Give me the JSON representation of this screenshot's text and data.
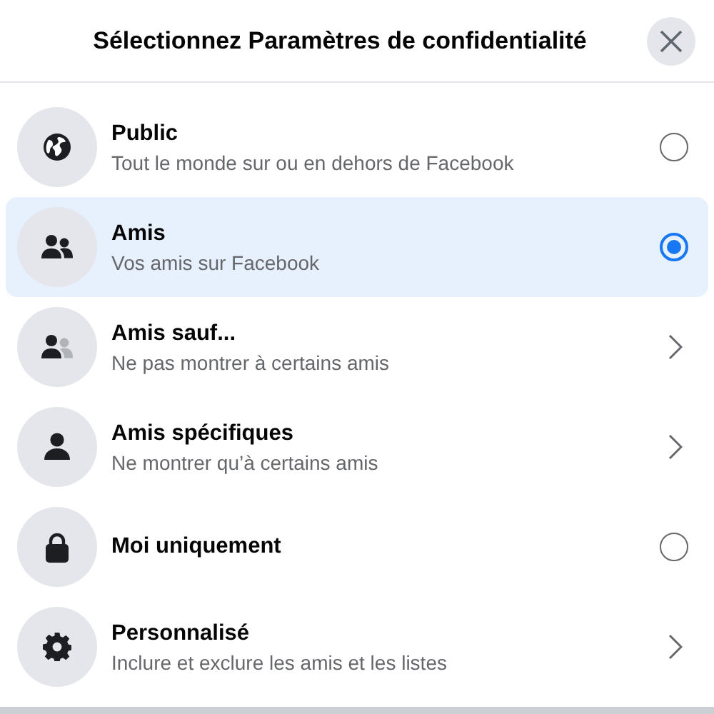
{
  "dialog": {
    "title": "Sélectionnez Paramètres de confidentialité"
  },
  "options": [
    {
      "title": "Public",
      "subtitle": "Tout le monde sur ou en dehors de Facebook",
      "kind": "radio",
      "selected": false
    },
    {
      "title": "Amis",
      "subtitle": "Vos amis sur Facebook",
      "kind": "radio",
      "selected": true
    },
    {
      "title": "Amis sauf...",
      "subtitle": "Ne pas montrer à certains amis",
      "kind": "chevron",
      "selected": false
    },
    {
      "title": "Amis spécifiques",
      "subtitle": "Ne montrer qu’à certains amis",
      "kind": "chevron",
      "selected": false
    },
    {
      "title": "Moi uniquement",
      "kind": "radio",
      "selected": false
    },
    {
      "title": "Personnalisé",
      "subtitle": "Inclure et exclure les amis et les listes",
      "kind": "chevron",
      "selected": false
    }
  ]
}
